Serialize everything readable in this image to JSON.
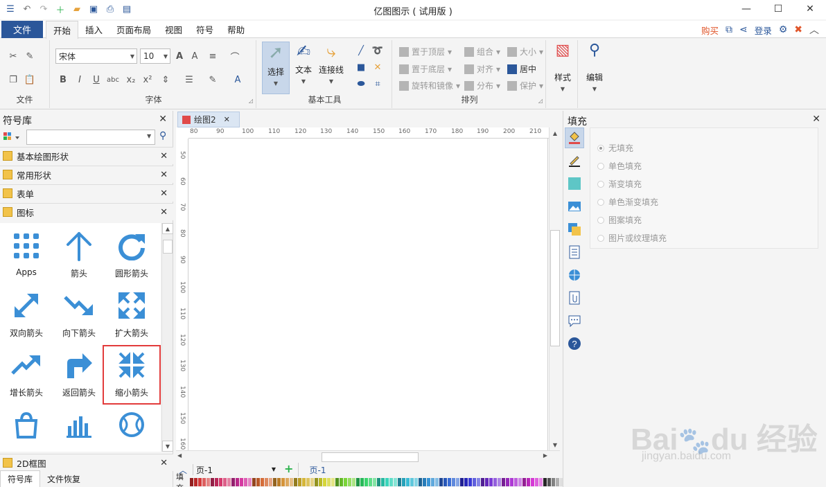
{
  "app": {
    "title": "亿图图示 ( 试用版 )",
    "window_controls": [
      "—",
      "☐",
      "✕"
    ]
  },
  "menu": {
    "file": "文件",
    "tabs": [
      "开始",
      "插入",
      "页面布局",
      "视图",
      "符号",
      "帮助"
    ],
    "active_tab": "开始",
    "buy": "购买",
    "login": "登录"
  },
  "ribbon": {
    "file_group": {
      "label": "文件"
    },
    "font_group": {
      "label": "字体",
      "font_name": "宋体",
      "font_size": "10"
    },
    "tools_group": {
      "label": "基本工具",
      "select": "选择",
      "text": "文本",
      "connector": "连接线"
    },
    "arrange_group": {
      "label": "排列",
      "items": [
        "置于顶层",
        "置于底层",
        "旋转和镜像",
        "组合",
        "对齐",
        "分布",
        "大小",
        "居中",
        "保护"
      ]
    },
    "style": "样式",
    "edit": "编辑"
  },
  "left_panel": {
    "title": "符号库",
    "search_placeholder": "",
    "categories": [
      "基本绘图形状",
      "常用形状",
      "表单",
      "图标"
    ],
    "bottom_category": "2D框图",
    "icons": [
      {
        "label": "Apps",
        "icon": "apps-grid-icon"
      },
      {
        "label": "箭头",
        "icon": "arrow-up-icon"
      },
      {
        "label": "圆形箭头",
        "icon": "circular-arrow-icon"
      },
      {
        "label": "双向箭头",
        "icon": "double-arrow-icon"
      },
      {
        "label": "向下箭头",
        "icon": "trend-down-arrow-icon"
      },
      {
        "label": "扩大箭头",
        "icon": "expand-arrows-icon"
      },
      {
        "label": "增长箭头",
        "icon": "trend-up-arrow-icon"
      },
      {
        "label": "返回箭头",
        "icon": "return-arrow-icon"
      },
      {
        "label": "缩小箭头",
        "icon": "shrink-arrows-icon"
      },
      {
        "label": "",
        "icon": "shopping-bag-icon"
      },
      {
        "label": "",
        "icon": "bar-chart-icon"
      },
      {
        "label": "",
        "icon": "baseball-icon"
      }
    ],
    "highlighted_icon": "缩小箭头",
    "tabs": [
      "符号库",
      "文件恢复"
    ]
  },
  "canvas": {
    "doc_tab": "绘图2",
    "hruler": [
      "80",
      "90",
      "100",
      "110",
      "120",
      "130",
      "140",
      "150",
      "160",
      "170",
      "180",
      "190",
      "200",
      "210"
    ],
    "vruler": [
      "50",
      "60",
      "70",
      "80",
      "90",
      "100",
      "110",
      "120",
      "130",
      "140",
      "150",
      "160"
    ],
    "page_selector": "页-1",
    "page_tab": "页-1",
    "fill_label": "填充"
  },
  "right_panel": {
    "title": "填充",
    "options": [
      "无填充",
      "单色填充",
      "渐变填充",
      "单色渐变填充",
      "图案填充",
      "图片或纹理填充"
    ],
    "selected": "无填充"
  },
  "watermark": {
    "logo": "Bai度经验",
    "url": "jingyan.baidu.com"
  },
  "colors": {
    "accent": "#2b579a",
    "icon_blue": "#3b8fd6",
    "highlight": "#e23b3b",
    "buy": "#e0552a"
  }
}
